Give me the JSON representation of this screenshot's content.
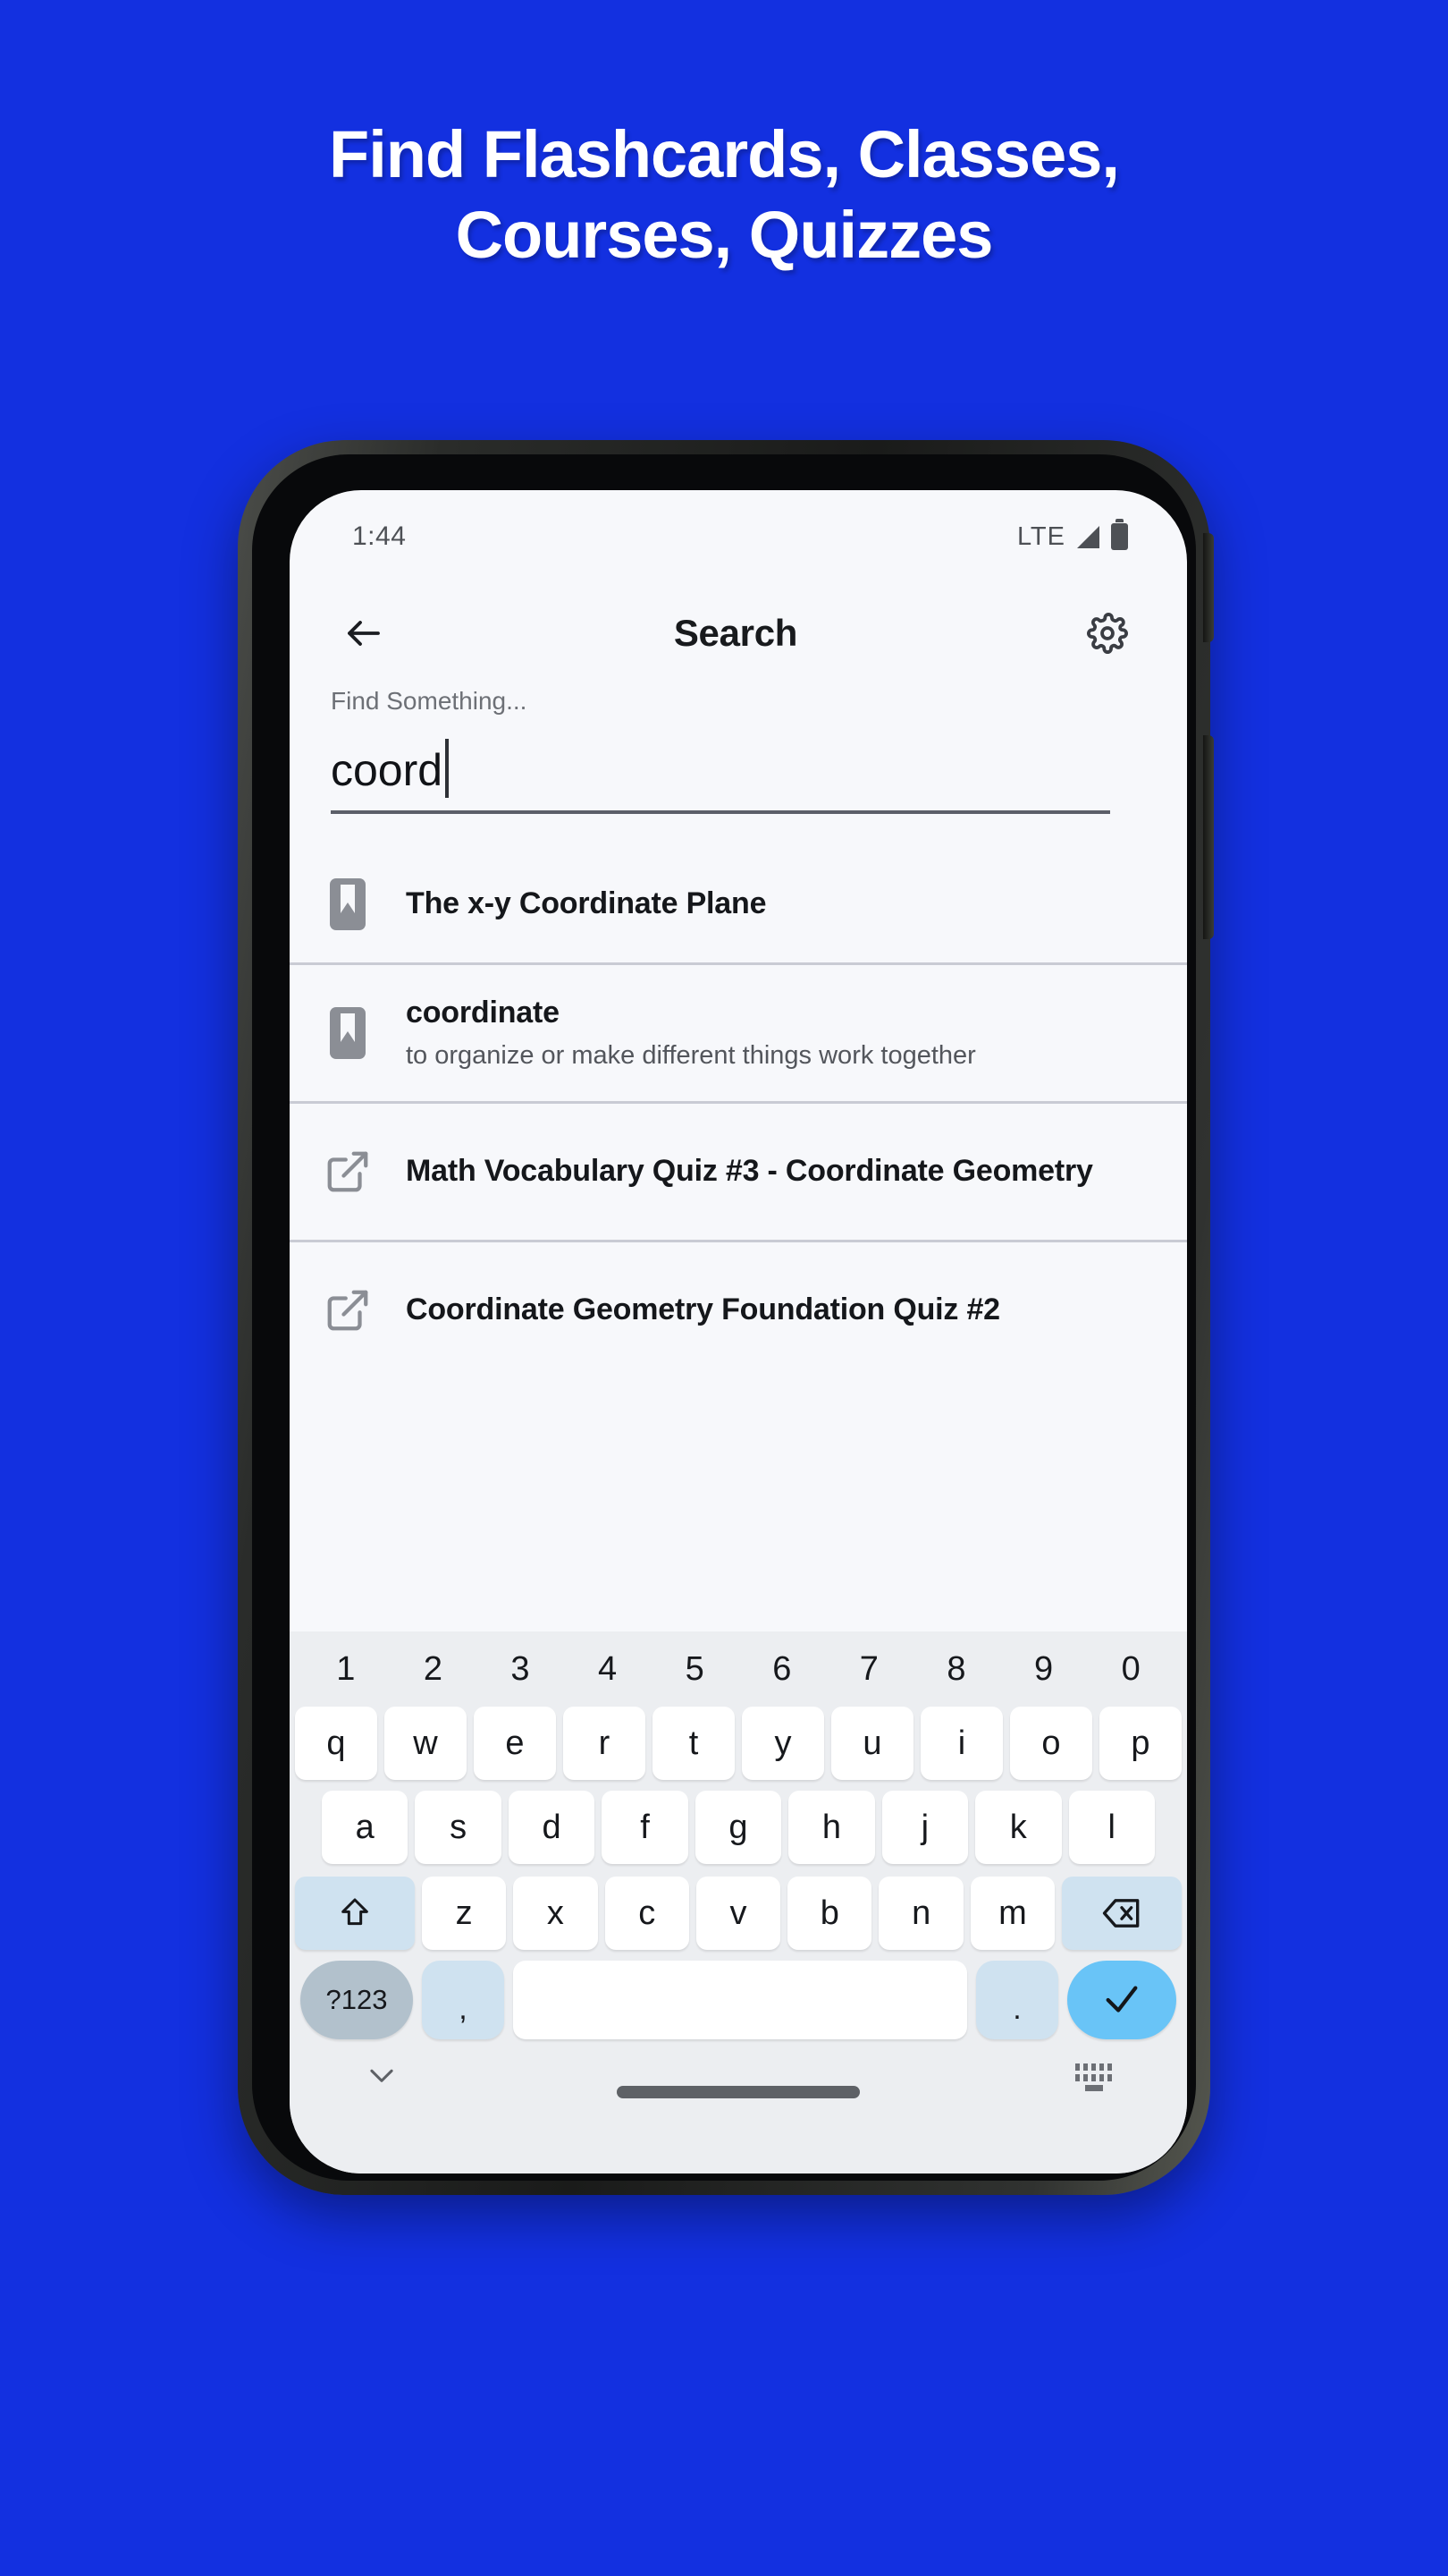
{
  "promo": {
    "headline_line1": "Find Flashcards, Classes,",
    "headline_line2": "Courses, Quizzes",
    "background_color": "#1330e0",
    "headline_color": "#ffffff"
  },
  "status_bar": {
    "time": "1:44",
    "network": "LTE",
    "signal_icon": "signal-triangle-icon",
    "battery_icon": "battery-full-icon"
  },
  "app_bar": {
    "back_icon": "arrow-left-icon",
    "title": "Search",
    "settings_icon": "gear-icon"
  },
  "search": {
    "label": "Find Something...",
    "value": "coord",
    "placeholder": "Find Something..."
  },
  "results": [
    {
      "icon": "bookmark-icon",
      "type": "flashcard-set",
      "title": "The x-y Coordinate Plane",
      "subtitle": ""
    },
    {
      "icon": "bookmark-icon",
      "type": "flashcard-term",
      "title": "coordinate",
      "subtitle": "to organize or make different things work together"
    },
    {
      "icon": "external-link-icon",
      "type": "quiz",
      "title": "Math Vocabulary Quiz #3 - Coordinate Geometry",
      "subtitle": ""
    },
    {
      "icon": "external-link-icon",
      "type": "quiz",
      "title": "Coordinate Geometry Foundation Quiz #2",
      "subtitle": ""
    }
  ],
  "keyboard": {
    "number_row": [
      "1",
      "2",
      "3",
      "4",
      "5",
      "6",
      "7",
      "8",
      "9",
      "0"
    ],
    "row1": [
      "q",
      "w",
      "e",
      "r",
      "t",
      "y",
      "u",
      "i",
      "o",
      "p"
    ],
    "row2": [
      "a",
      "s",
      "d",
      "f",
      "g",
      "h",
      "j",
      "k",
      "l"
    ],
    "row3_letters": [
      "z",
      "x",
      "c",
      "v",
      "b",
      "n",
      "m"
    ],
    "shift_icon": "shift-arrow-up-icon",
    "backspace_icon": "backspace-delete-icon",
    "symbols_key": "?123",
    "comma_key": ",",
    "space_key": "",
    "period_key": ".",
    "enter_icon": "checkmark-icon",
    "key_color": "#ffffff",
    "modifier_color": "#cfe2f0",
    "enter_color": "#69c4f7",
    "symbols_color": "#b2c1cc",
    "background_color": "#eceef1"
  },
  "nav_bar": {
    "hide_keyboard_icon": "chevron-down-icon",
    "switch_keyboard_icon": "keyboard-switch-icon",
    "home_indicator": "home-indicator-pill"
  }
}
